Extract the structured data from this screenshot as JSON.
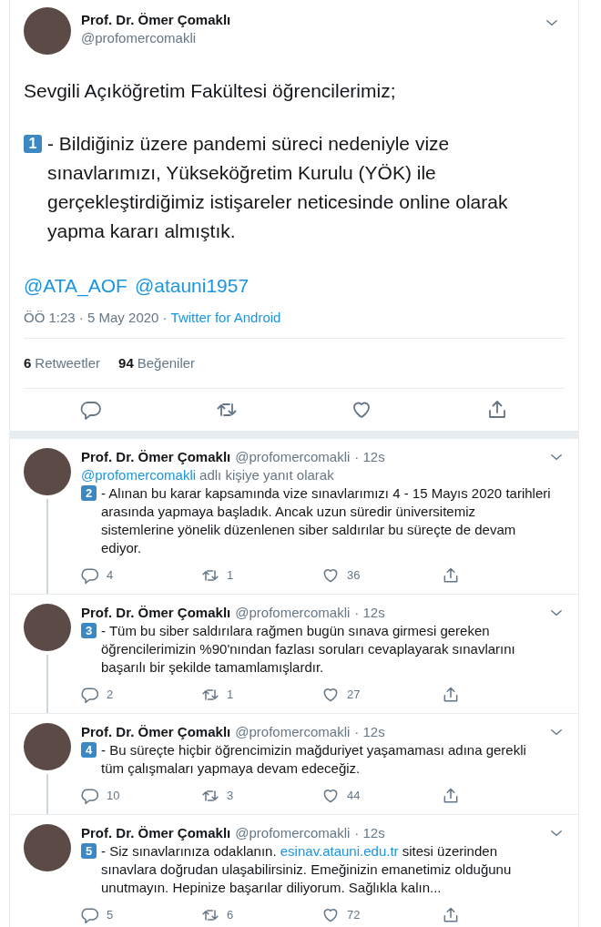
{
  "main_tweet": {
    "author": {
      "name": "Prof. Dr. Ömer Çomaklı",
      "handle": "@profomercomakli"
    },
    "greeting": "Sevgili Açıköğretim Fakültesi öğrencilerimiz;",
    "item": {
      "number": "1",
      "text": "- Bildiğiniz üzere pandemi süreci nedeniyle vize sınavlarımızı, Yükseköğretim Kurulu (YÖK) ile gerçekleştirdiğimiz istişareler neticesinde online olarak yapma kararı almıştık."
    },
    "mentions": [
      "@ATA_AOF",
      "@atauni1957"
    ],
    "time": "ÖÖ 1:23 · 5 May 2020 ·",
    "source": "Twitter for Android",
    "stats": [
      {
        "count": "6",
        "label": "Retweetler"
      },
      {
        "count": "94",
        "label": "Beğeniler"
      }
    ]
  },
  "replies": [
    {
      "name": "Prof. Dr. Ömer Çomaklı",
      "handle": "@profomercomakli",
      "time": "· 12s",
      "replying_to": {
        "handle": "@profomercomakli",
        "text": "adlı kişiye yanıt olarak"
      },
      "number": "2",
      "segments": [
        {
          "kind": "text",
          "text": "- Alınan bu karar kapsamında vize sınavlarımızı 4 - 15 Mayıs 2020 tarihleri arasında yapmaya başladık. Ancak uzun süredir üniversitemiz sistemlerine yönelik düzenlenen siber saldırılar bu süreçte de devam ediyor."
        }
      ],
      "replies": "4",
      "retweets": "1",
      "likes": "36"
    },
    {
      "name": "Prof. Dr. Ömer Çomaklı",
      "handle": "@profomercomakli",
      "time": "· 12s",
      "number": "3",
      "segments": [
        {
          "kind": "text",
          "text": "- Tüm bu siber saldırılara rağmen bugün sınava girmesi gereken öğrencilerimizin %90'nından fazlası soruları cevaplayarak sınavlarını başarılı bir şekilde tamamlamışlardır."
        }
      ],
      "replies": "2",
      "retweets": "1",
      "likes": "27"
    },
    {
      "name": "Prof. Dr. Ömer Çomaklı",
      "handle": "@profomercomakli",
      "time": "· 12s",
      "number": "4",
      "segments": [
        {
          "kind": "text",
          "text": "- Bu süreçte hiçbir öğrencimizin mağduriyet yaşamaması adına gerekli tüm çalışmaları yapmaya devam edeceğiz."
        }
      ],
      "replies": "10",
      "retweets": "3",
      "likes": "44"
    },
    {
      "name": "Prof. Dr. Ömer Çomaklı",
      "handle": "@profomercomakli",
      "time": "· 12s",
      "number": "5",
      "segments": [
        {
          "kind": "text",
          "text": "- Siz sınavlarınıza odaklanın. "
        },
        {
          "kind": "link",
          "text": "esinav.atauni.edu.tr"
        },
        {
          "kind": "text",
          "text": " sitesi üzerinden sınavlara doğrudan ulaşabilirsiniz. Emeğinizin emanetimiz olduğunu unutmayın. Hepinize başarılar diliyorum. Sağlıkla kalın..."
        }
      ],
      "replies": "5",
      "retweets": "6",
      "likes": "72"
    }
  ]
}
